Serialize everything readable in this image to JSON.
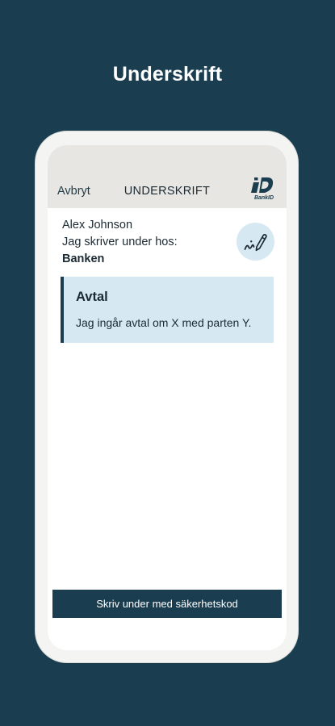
{
  "hero": {
    "title": "Underskrift"
  },
  "nav": {
    "cancel_label": "Avbryt",
    "title": "UNDERSKRIFT",
    "logo_text": "BankID"
  },
  "signer": {
    "name": "Alex Johnson",
    "intro": "Jag skriver under hos:",
    "organization": "Banken"
  },
  "agreement": {
    "heading": "Avtal",
    "text": "Jag ingår avtal om X med parten Y."
  },
  "actions": {
    "sign_button_label": "Skriv under med säkerhetskod"
  },
  "colors": {
    "background": "#1a3e50",
    "nav_bar": "#e8e6e2",
    "card": "#d6e9f3",
    "accent": "#1a3e50"
  },
  "icons": {
    "sign": "signature-pen-icon",
    "logo": "bankid-logo"
  }
}
